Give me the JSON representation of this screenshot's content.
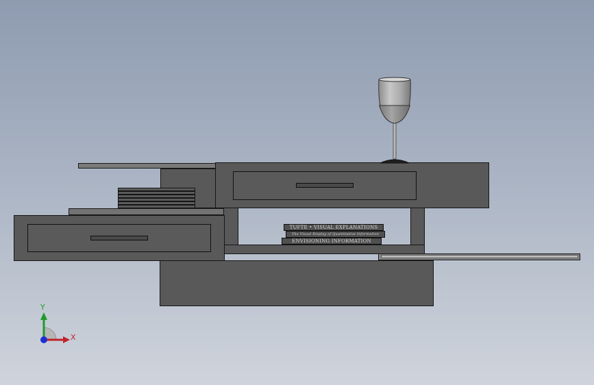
{
  "books": [
    {
      "spine": "TUFTE • VISUAL EXPLANATIONS"
    },
    {
      "spine": "The Visual Display of Quantitative Information"
    },
    {
      "spine": "ENVISIONING INFORMATION"
    }
  ],
  "triad": {
    "x_label": "X",
    "y_label": "Y",
    "colors": {
      "x": "#c0232b",
      "y": "#1f9a2c",
      "z": "#1d2fd0"
    }
  },
  "background": {
    "top": "#8e9bb0",
    "bottom": "#cfd4dc"
  }
}
